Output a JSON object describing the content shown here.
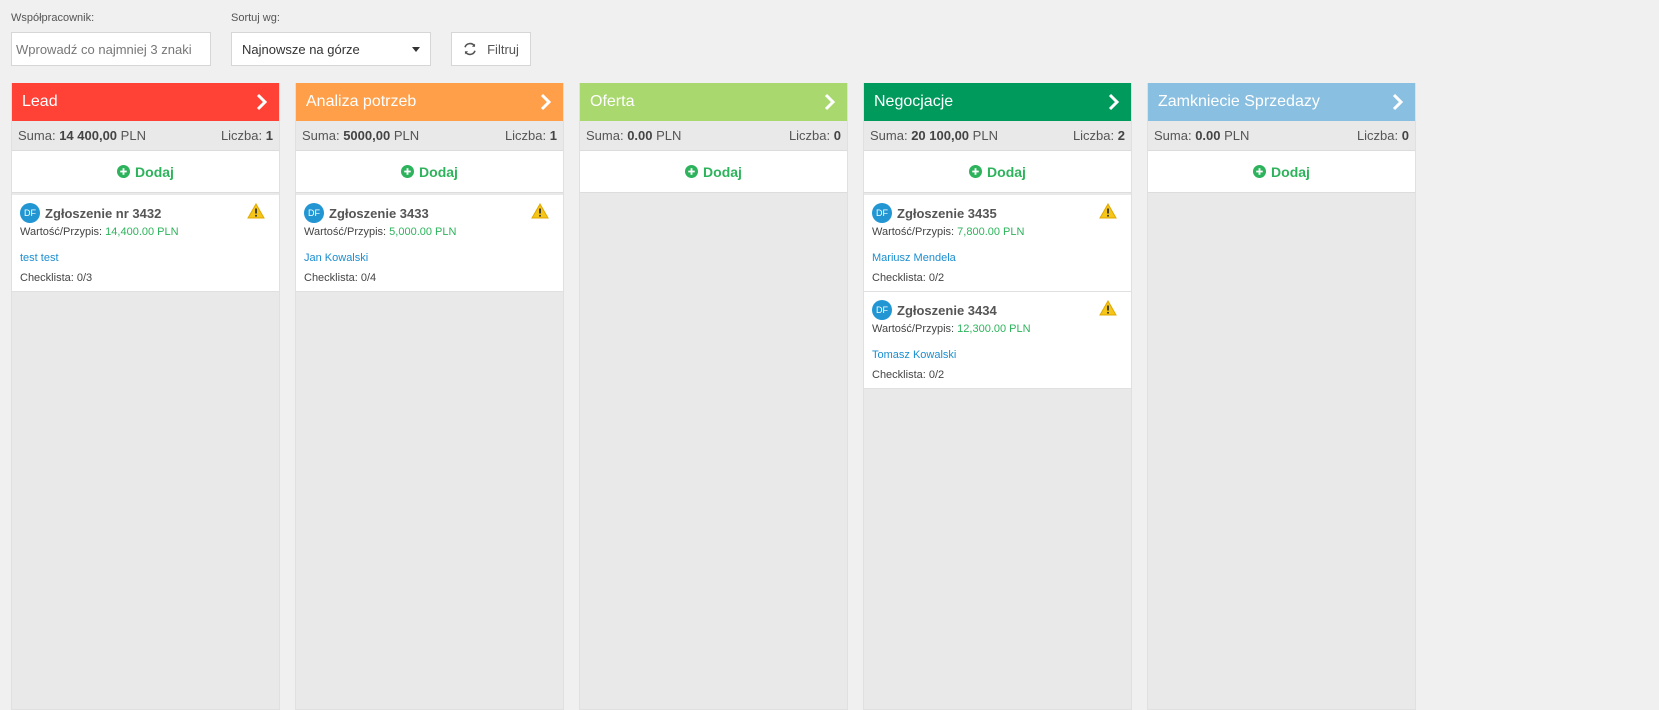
{
  "filters": {
    "employee_label": "Współpracownik:",
    "employee_placeholder": "Wprowadź co najmniej 3 znaki",
    "sort_label": "Sortuj wg:",
    "sort_value": "Najnowsze na górze",
    "filter_button": "Filtruj"
  },
  "columns": [
    {
      "title": "Lead",
      "color": "#ff4136",
      "sum_label": "Suma:",
      "sum_value": "14 400,00",
      "currency": "PLN",
      "count_label": "Liczba:",
      "count": "1",
      "add_label": "Dodaj",
      "cards": [
        {
          "avatar": "DF",
          "title": "Zgłoszenie nr 3432",
          "value_label": "Wartość/Przypis:",
          "value": "14,400.00 PLN",
          "person": "test test",
          "checklist": "Checklista: 0/3"
        }
      ]
    },
    {
      "title": "Analiza potrzeb",
      "color": "#ff9f4a",
      "sum_label": "Suma:",
      "sum_value": "5000,00",
      "currency": "PLN",
      "count_label": "Liczba:",
      "count": "1",
      "add_label": "Dodaj",
      "cards": [
        {
          "avatar": "DF",
          "title": "Zgłoszenie 3433",
          "value_label": "Wartość/Przypis:",
          "value": "5,000.00 PLN",
          "person": "Jan Kowalski",
          "checklist": "Checklista: 0/4"
        }
      ]
    },
    {
      "title": "Oferta",
      "color": "#a8d86e",
      "sum_label": "Suma:",
      "sum_value": "0.00",
      "currency": "PLN",
      "count_label": "Liczba:",
      "count": "0",
      "add_label": "Dodaj",
      "cards": []
    },
    {
      "title": "Negocjacje",
      "color": "#009a5c",
      "sum_label": "Suma:",
      "sum_value": "20 100,00",
      "currency": "PLN",
      "count_label": "Liczba:",
      "count": "2",
      "add_label": "Dodaj",
      "cards": [
        {
          "avatar": "DF",
          "title": "Zgłoszenie 3435",
          "value_label": "Wartość/Przypis:",
          "value": "7,800.00 PLN",
          "person": "Mariusz Mendela",
          "checklist": "Checklista: 0/2"
        },
        {
          "avatar": "DF",
          "title": "Zgłoszenie 3434",
          "value_label": "Wartość/Przypis:",
          "value": "12,300.00 PLN",
          "person": "Tomasz Kowalski",
          "checklist": "Checklista: 0/2"
        }
      ]
    },
    {
      "title": "Zamkniecie Sprzedazy",
      "color": "#89bfe0",
      "sum_label": "Suma:",
      "sum_value": "0.00",
      "currency": "PLN",
      "count_label": "Liczba:",
      "count": "0",
      "add_label": "Dodaj",
      "cards": []
    }
  ]
}
